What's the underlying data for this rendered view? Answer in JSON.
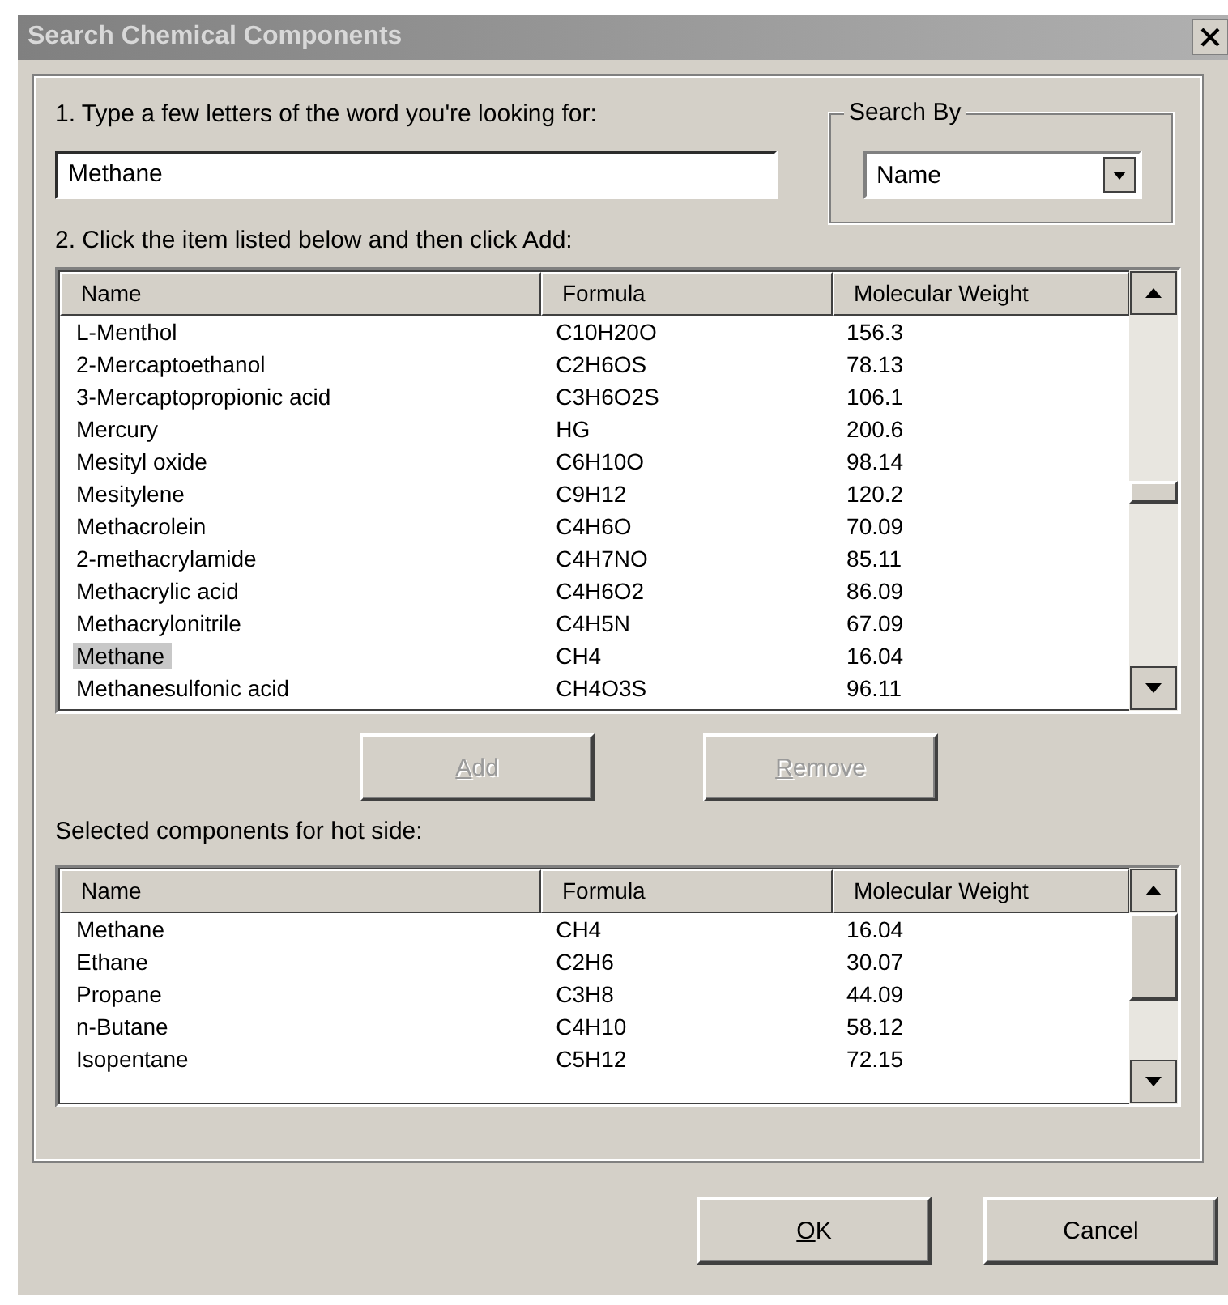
{
  "window": {
    "title": "Search Chemical Components"
  },
  "search": {
    "label": "1. Type a few letters of the word you're looking for:",
    "value": "Methane"
  },
  "search_by": {
    "legend": "Search By",
    "value": "Name"
  },
  "available": {
    "label": "2. Click the item listed below and then click Add:",
    "columns": [
      "Name",
      "Formula",
      "Molecular Weight"
    ],
    "rows": [
      {
        "name": "L-Menthol",
        "formula": "C10H20O",
        "molecular_weight": "156.3",
        "selected": false
      },
      {
        "name": "2-Mercaptoethanol",
        "formula": "C2H6OS",
        "molecular_weight": "78.13",
        "selected": false
      },
      {
        "name": "3-Mercaptopropionic acid",
        "formula": "C3H6O2S",
        "molecular_weight": "106.1",
        "selected": false
      },
      {
        "name": "Mercury",
        "formula": "HG",
        "molecular_weight": "200.6",
        "selected": false
      },
      {
        "name": "Mesityl oxide",
        "formula": "C6H10O",
        "molecular_weight": "98.14",
        "selected": false
      },
      {
        "name": "Mesitylene",
        "formula": "C9H12",
        "molecular_weight": "120.2",
        "selected": false
      },
      {
        "name": "Methacrolein",
        "formula": "C4H6O",
        "molecular_weight": "70.09",
        "selected": false
      },
      {
        "name": "2-methacrylamide",
        "formula": "C4H7NO",
        "molecular_weight": "85.11",
        "selected": false
      },
      {
        "name": "Methacrylic acid",
        "formula": "C4H6O2",
        "molecular_weight": "86.09",
        "selected": false
      },
      {
        "name": "Methacrylonitrile",
        "formula": "C4H5N",
        "molecular_weight": "67.09",
        "selected": false
      },
      {
        "name": "Methane",
        "formula": "CH4",
        "molecular_weight": "16.04",
        "selected": true
      },
      {
        "name": "Methanesulfonic acid",
        "formula": "CH4O3S",
        "molecular_weight": "96.11",
        "selected": false
      }
    ]
  },
  "actions": [
    {
      "label": "Add",
      "disabled": true,
      "underline_first": true
    },
    {
      "label": "Remove",
      "disabled": true,
      "underline_first": true
    }
  ],
  "selected_components": {
    "label": "Selected components for hot side:",
    "columns": [
      "Name",
      "Formula",
      "Molecular Weight"
    ],
    "rows": [
      {
        "name": "Methane",
        "formula": "CH4",
        "molecular_weight": "16.04",
        "selected": false
      },
      {
        "name": "Ethane",
        "formula": "C2H6",
        "molecular_weight": "30.07",
        "selected": false
      },
      {
        "name": "Propane",
        "formula": "C3H8",
        "molecular_weight": "44.09",
        "selected": false
      },
      {
        "name": "n-Butane",
        "formula": "C4H10",
        "molecular_weight": "58.12",
        "selected": false
      },
      {
        "name": "Isopentane",
        "formula": "C5H12",
        "molecular_weight": "72.15",
        "selected": false
      }
    ]
  },
  "buttons": [
    {
      "label": "OK",
      "disabled": false,
      "underline_first": true
    },
    {
      "label": "Cancel",
      "disabled": false,
      "underline_first": false
    }
  ]
}
